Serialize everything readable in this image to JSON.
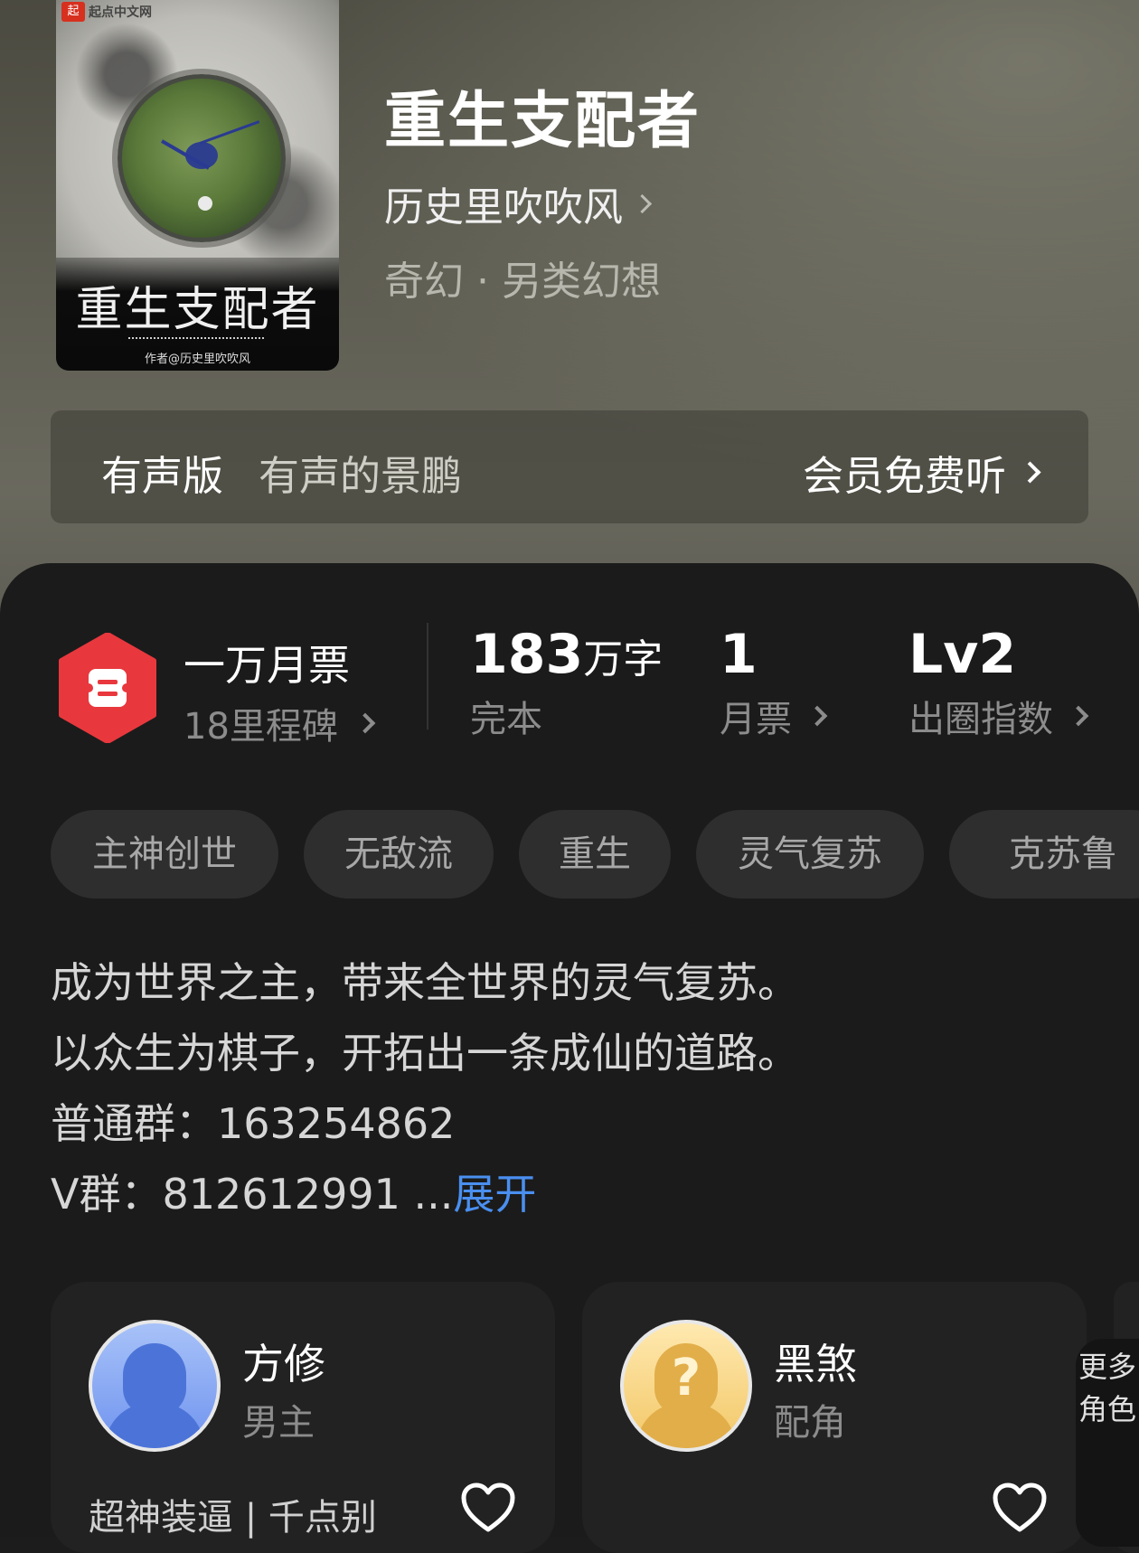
{
  "book": {
    "cover": {
      "publisher": "起点中文网",
      "title": "重生支配者",
      "author_line": "作者@历史里吹吹风"
    },
    "title": "重生支配者",
    "author": "历史里吹吹风",
    "genre": "奇幻 · 另类幻想"
  },
  "audio": {
    "label": "有声版",
    "narrator": "有声的景鹏",
    "cta": "会员免费听"
  },
  "stats": {
    "ticket_title": "一万月票",
    "ticket_sub": "18里程碑",
    "words_num": "183",
    "words_unit": "万字",
    "words_label": "完本",
    "monthly_num": "1",
    "monthly_label": "月票",
    "circle_num": "Lv2",
    "circle_label": "出圈指数"
  },
  "tags": [
    "主神创世",
    "无敌流",
    "重生",
    "灵气复苏",
    "克苏鲁"
  ],
  "description": {
    "line1": "成为世界之主，带来全世界的灵气复苏。",
    "line2": "以众生为棋子，开拓出一条成仙的道路。",
    "line3": "普通群：163254862",
    "line4": "V群：812612991 ...",
    "expand": "展开"
  },
  "characters": [
    {
      "name": "方修",
      "role": "男主",
      "desc": "超神装逼 | 千点别"
    },
    {
      "name": "黑煞",
      "role": "配角",
      "desc": ""
    }
  ],
  "more_roles": "更多角色",
  "colors": {
    "accent_blue": "#4a8ff0",
    "ticket_red": "#e8383d"
  }
}
